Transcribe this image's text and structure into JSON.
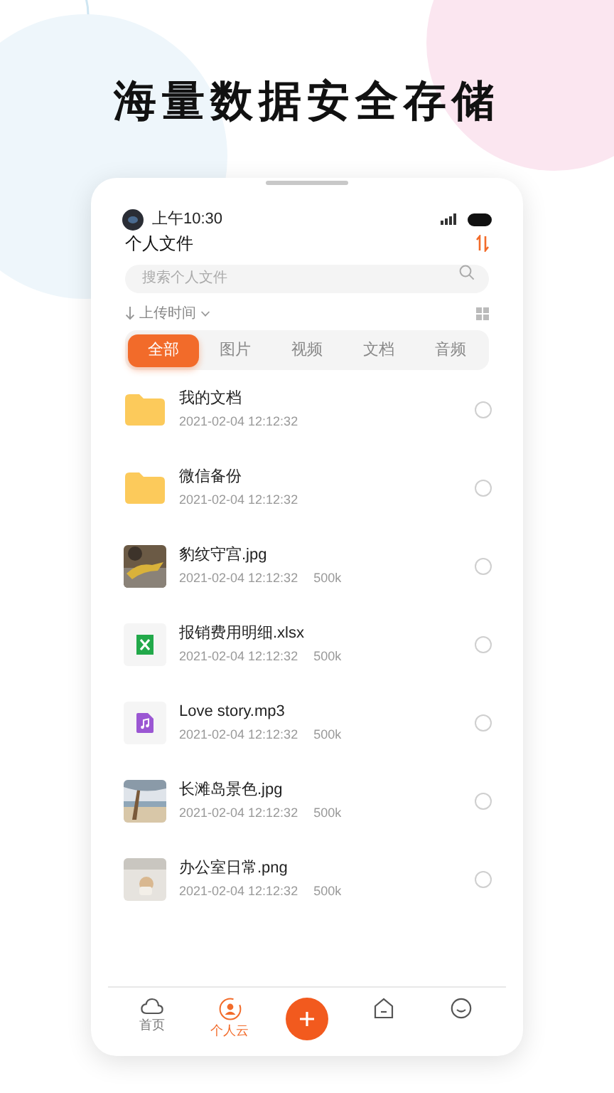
{
  "headline": "海量数据安全存储",
  "status_bar": {
    "time": "上午10:30"
  },
  "header": {
    "title": "个人文件"
  },
  "search": {
    "placeholder": "搜索个人文件"
  },
  "sort": {
    "label": "上传时间"
  },
  "tabs": [
    {
      "label": "全部",
      "selected": true
    },
    {
      "label": "图片",
      "selected": false
    },
    {
      "label": "视频",
      "selected": false
    },
    {
      "label": "文档",
      "selected": false
    },
    {
      "label": "音频",
      "selected": false
    }
  ],
  "files": [
    {
      "kind": "folder",
      "name": "我的文档",
      "date": "2021-02-04 12:12:32",
      "selected": false
    },
    {
      "kind": "folder",
      "name": "微信备份",
      "date": "2021-02-04 12:12:32",
      "selected": false
    },
    {
      "name": "豹纹守宫.jpg",
      "date": "2021-02-04 12:12:32",
      "size": "500k",
      "selected": false
    },
    {
      "kind": "sheet",
      "name": "报销费用明细.xlsx",
      "date": "2021-02-04 12:12:32",
      "size": "500k",
      "selected": false
    },
    {
      "kind": "audio",
      "name": "Love story.mp3",
      "date": "2021-02-04 12:12:32",
      "size": "500k",
      "selected": false
    },
    {
      "name": "长滩岛景色.jpg",
      "date": "2021-02-04 12:12:32",
      "size": "500k",
      "selected": false
    },
    {
      "name": "办公室日常.png",
      "date": "2021-02-04 12:12:32",
      "size": "500k",
      "selected": false
    }
  ],
  "bottom_nav": [
    {
      "kind": "cloud",
      "label": "首页",
      "selected": false
    },
    {
      "kind": "profile",
      "label": "个人云",
      "selected": true
    },
    {
      "kind": "add"
    },
    {
      "kind": "house",
      "selected": false
    },
    {
      "kind": "face",
      "selected": false
    }
  ]
}
